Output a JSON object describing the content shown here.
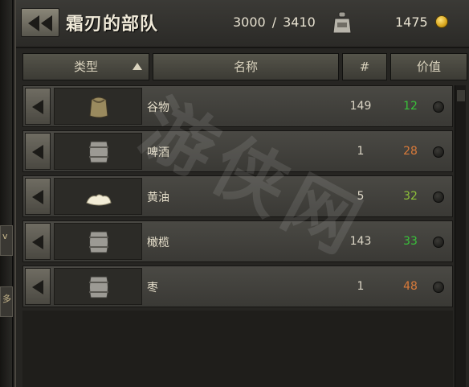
{
  "header": {
    "title": "霜刃的部队",
    "capacity_current": "3000",
    "capacity_sep": "/",
    "capacity_max": "3410",
    "gold": "1475"
  },
  "columns": {
    "type": "类型",
    "name": "名称",
    "count": "#",
    "value": "价值"
  },
  "items": [
    {
      "icon": "grain-sack-icon",
      "name": "谷物",
      "qty": "149",
      "value": "12",
      "value_color": "#39c23a"
    },
    {
      "icon": "barrel-icon",
      "name": "啤酒",
      "qty": "1",
      "value": "28",
      "value_color": "#d97a3a"
    },
    {
      "icon": "butter-icon",
      "name": "黄油",
      "qty": "5",
      "value": "32",
      "value_color": "#8ec13a"
    },
    {
      "icon": "barrel-icon",
      "name": "橄榄",
      "qty": "143",
      "value": "33",
      "value_color": "#39c23a"
    },
    {
      "icon": "barrel-icon",
      "name": "枣",
      "qty": "1",
      "value": "48",
      "value_color": "#d97a3a"
    }
  ],
  "left_tabs": [
    "v",
    "多"
  ],
  "watermark": "游侠网"
}
